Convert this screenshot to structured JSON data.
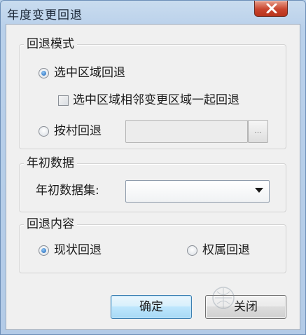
{
  "window": {
    "title": "年度变更回退"
  },
  "rollback_mode": {
    "legend": "回退模式",
    "option_selected_area": {
      "label": "选中区域回退",
      "selected": true
    },
    "with_adjacent": {
      "label": "选中区域相邻变更区域一起回退",
      "checked": false
    },
    "option_by_village": {
      "label": "按村回退",
      "selected": false
    },
    "village_value": "",
    "browse_label": "..."
  },
  "initial_data": {
    "legend": "年初数据",
    "dataset_label": "年初数据集:",
    "dataset_value": ""
  },
  "rollback_content": {
    "legend": "回退内容",
    "option_status": {
      "label": "现状回退",
      "selected": true
    },
    "option_ownership": {
      "label": "权属回退",
      "selected": false
    }
  },
  "buttons": {
    "ok": "确定",
    "close": "关闭"
  },
  "colors": {
    "accent": "#1b62b5",
    "close_red": "#c9452e"
  }
}
